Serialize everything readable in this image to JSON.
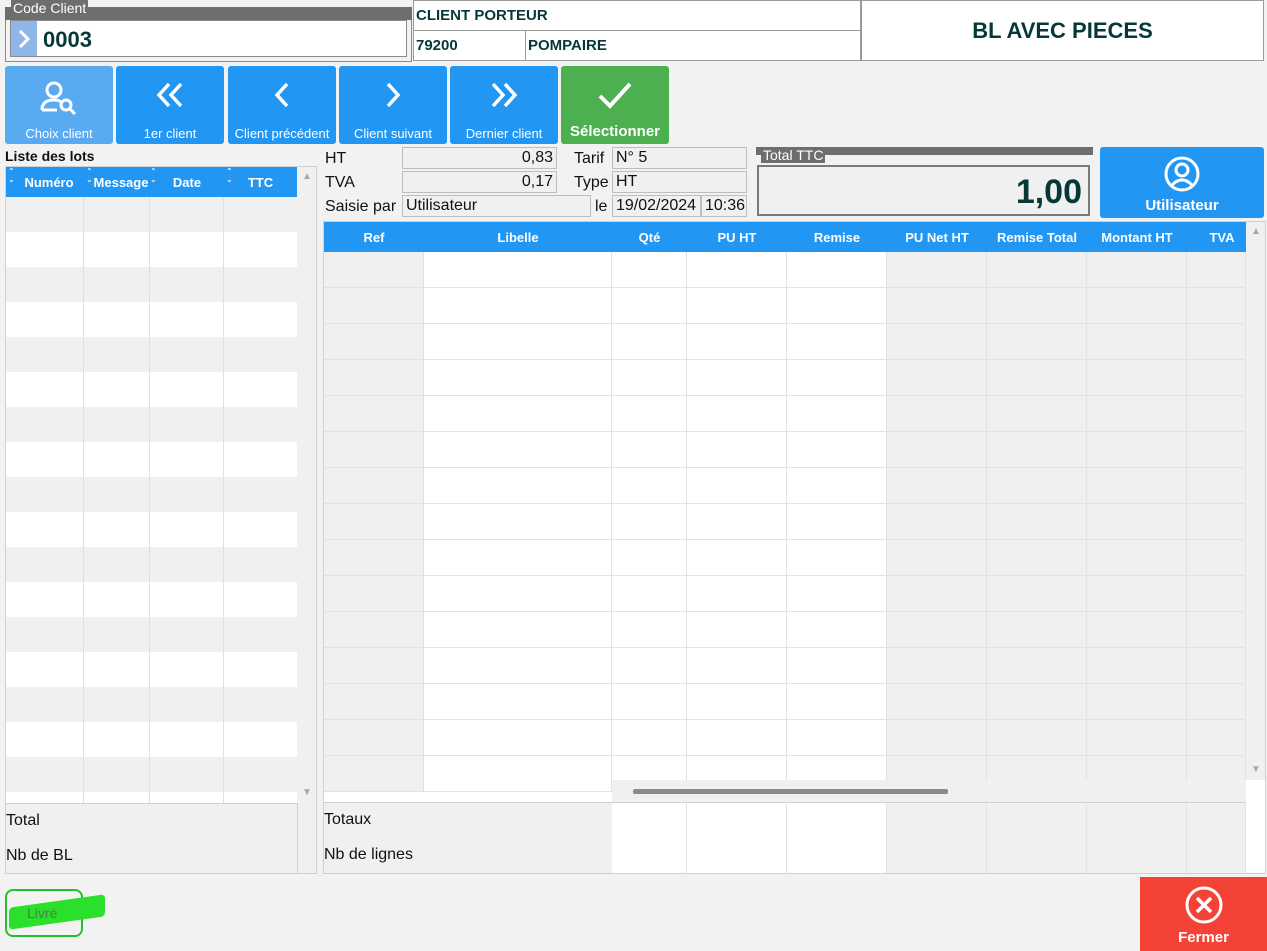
{
  "client": {
    "code_label": "Code Client",
    "code_value": "0003",
    "name": "CLIENT PORTEUR",
    "postcode": "79200",
    "city": "POMPAIRE"
  },
  "document_title": "BL AVEC PIECES",
  "toolbar": {
    "choose_label": "Choix client",
    "first_label": "1er client",
    "prev_label": "Client précédent",
    "next_label": "Client suivant",
    "last_label": "Dernier client",
    "select_label": "Sélectionner"
  },
  "lots": {
    "title": "Liste des lots",
    "columns": [
      "Numéro",
      "Message",
      "Date",
      "TTC"
    ],
    "total_label": "Total",
    "count_label": "Nb de BL"
  },
  "summary": {
    "ht_label": "HT",
    "ht_value": "0,83",
    "tva_label": "TVA",
    "tva_value": "0,17",
    "entered_by_label": "Saisie par",
    "entered_by_value": "Utilisateur",
    "tarif_label": "Tarif",
    "tarif_value": "N° 5",
    "type_label": "Type",
    "type_value": "HT",
    "date_label": "le",
    "date_value": "19/02/2024",
    "time_value": "10:36",
    "total_ttc_label": "Total TTC",
    "total_ttc_value": "1,00"
  },
  "user_button_label": "Utilisateur",
  "lines": {
    "columns": [
      "Ref",
      "Libelle",
      "Qté",
      "PU HT",
      "Remise",
      "PU Net HT",
      "Remise Total",
      "Montant HT",
      "TVA"
    ],
    "totals_label": "Totaux",
    "count_label": "Nb de lignes"
  },
  "livre_label": "Livré",
  "close_label": "Fermer",
  "colors": {
    "accent": "#2196f3",
    "success": "#4caf50",
    "danger": "#f44336",
    "text": "#073838"
  }
}
